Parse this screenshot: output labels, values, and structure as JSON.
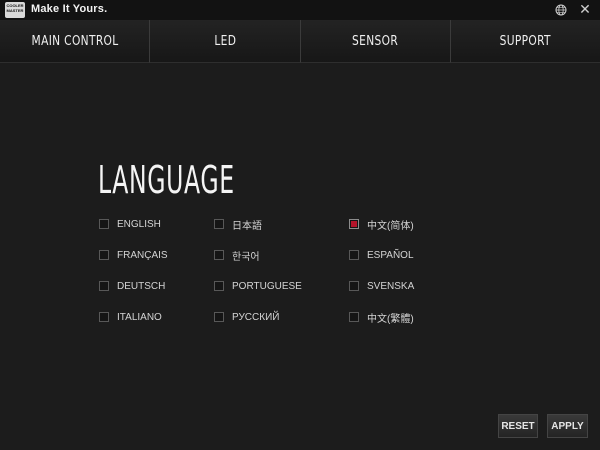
{
  "app": {
    "title": "Make It Yours.",
    "logo_text": "COOLER MASTER"
  },
  "nav": {
    "tabs": [
      {
        "label": "MAIN CONTROL"
      },
      {
        "label": "LED"
      },
      {
        "label": "SENSOR"
      },
      {
        "label": "SUPPORT"
      }
    ]
  },
  "language": {
    "title": "LANGUAGE",
    "options": [
      {
        "label": "ENGLISH",
        "checked": false
      },
      {
        "label": "日本語",
        "checked": false
      },
      {
        "label": "中文(简体)",
        "checked": true
      },
      {
        "label": "FRANÇAIS",
        "checked": false
      },
      {
        "label": "한국어",
        "checked": false
      },
      {
        "label": "ESPAÑOL",
        "checked": false
      },
      {
        "label": "DEUTSCH",
        "checked": false
      },
      {
        "label": "PORTUGUESE",
        "checked": false
      },
      {
        "label": "SVENSKA",
        "checked": false
      },
      {
        "label": "ITALIANO",
        "checked": false
      },
      {
        "label": "РУССКИЙ",
        "checked": false
      },
      {
        "label": "中文(繁體)",
        "checked": false
      }
    ]
  },
  "footer": {
    "reset_label": "RESET",
    "apply_label": "APPLY"
  },
  "colors": {
    "background": "#1c1c1c",
    "accent": "#b3142a"
  },
  "icons": {
    "globe": "globe-icon",
    "close": "close-icon",
    "logo": "brand-logo"
  }
}
